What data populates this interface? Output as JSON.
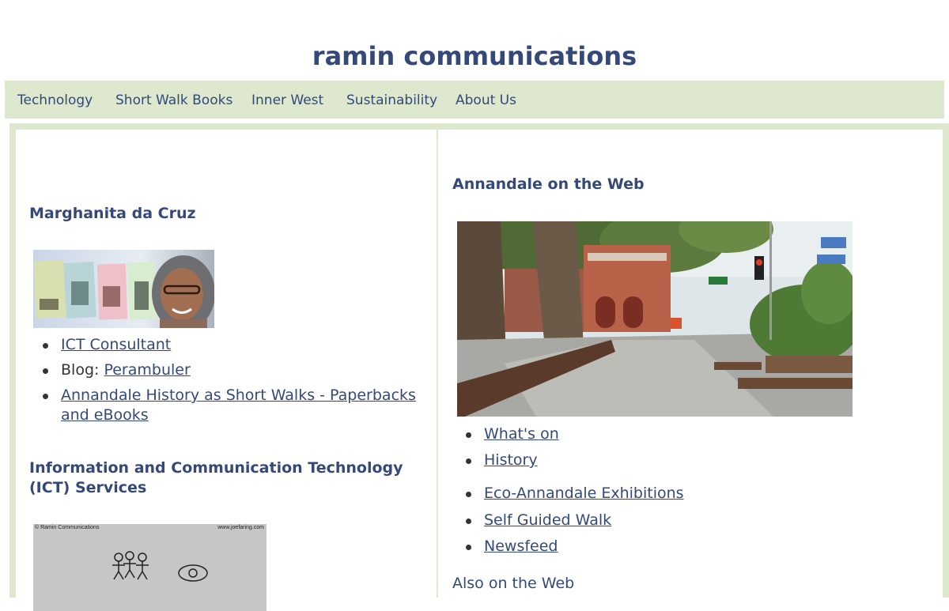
{
  "site": {
    "title": "ramin communications"
  },
  "nav": {
    "items": [
      {
        "label": "Technology"
      },
      {
        "label": "Short Walk Books"
      },
      {
        "label": "Inner West"
      },
      {
        "label": "Sustainability"
      },
      {
        "label": "About Us"
      }
    ]
  },
  "left": {
    "heading": "Marghanita da Cruz",
    "links": [
      {
        "label": "ICT Consultant"
      },
      {
        "prefix": "Blog: ",
        "label": "Perambuler"
      },
      {
        "label": "Annandale History as Short Walks - Paperbacks and eBooks"
      }
    ],
    "heading2": "Information and Communication Technology (ICT) Services",
    "cartoon": {
      "credit_left": "© Ramin Communications",
      "credit_right": "www.joefaring.com"
    }
  },
  "right": {
    "heading": "Annandale on the Web",
    "links": [
      {
        "label": "What's on"
      },
      {
        "label": "History"
      },
      {
        "label": "Eco-Annandale Exhibitions"
      },
      {
        "label": "Self Guided Walk"
      },
      {
        "label": "Newsfeed"
      }
    ],
    "heading2": "Also on the Web"
  },
  "colors": {
    "brand": "#34497a",
    "nav_bg": "#dde8cf",
    "frame_bg": "#dde8cf"
  }
}
